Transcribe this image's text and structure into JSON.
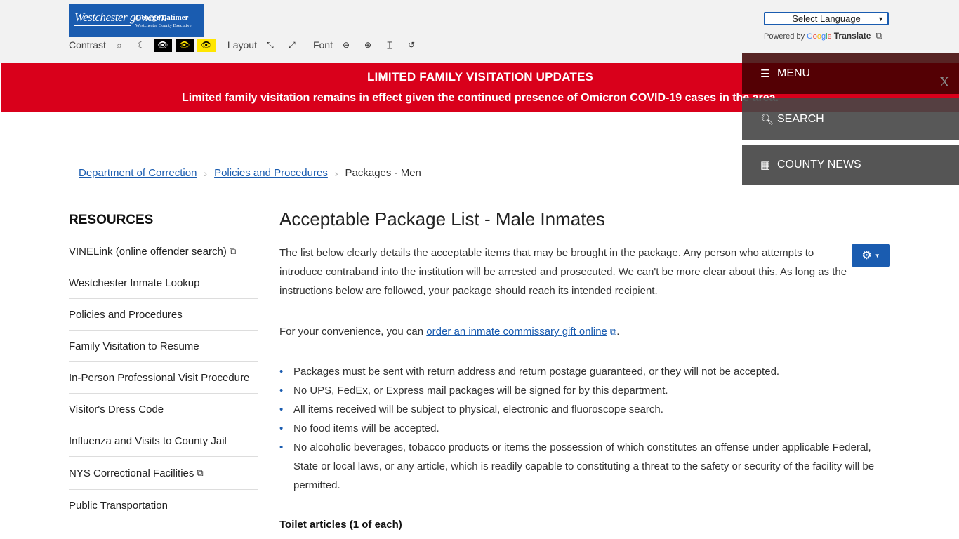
{
  "header": {
    "logo": {
      "site": "Westchester gov.com",
      "executive_name": "George Latimer",
      "executive_title": "Westchester County Executive"
    },
    "contrast_label": "Contrast",
    "layout_label": "Layout",
    "font_label": "Font",
    "language_select": {
      "selected": "Select Language"
    },
    "powered_by": "Powered by",
    "google": [
      "G",
      "o",
      "o",
      "g",
      "l",
      "e"
    ],
    "translate": "Translate"
  },
  "alert": {
    "title": "LIMITED FAMILY VISITATION UPDATES",
    "link_text": "Limited family visitation remains in effect",
    "text": " given the continued presence of Omicron COVID-19 cases in the area."
  },
  "side_menu": {
    "menu": "MENU",
    "search": "SEARCH",
    "news": "COUNTY NEWS",
    "close": "X"
  },
  "breadcrumb": {
    "items": [
      "Department of Correction",
      "Policies and Procedures"
    ],
    "current": "Packages - Men"
  },
  "sidebar": {
    "heading": "RESOURCES",
    "items": [
      {
        "label": "VINELink (online offender search)",
        "external": true
      },
      {
        "label": "Westchester Inmate Lookup",
        "external": false
      },
      {
        "label": "Policies and Procedures",
        "external": false
      },
      {
        "label": "Family Visitation to Resume",
        "external": false
      },
      {
        "label": "In-Person Professional Visit Procedure",
        "external": false
      },
      {
        "label": "Visitor's Dress Code",
        "external": false
      },
      {
        "label": "Influenza and Visits to County Jail",
        "external": false
      },
      {
        "label": "NYS Correctional Facilities",
        "external": true
      },
      {
        "label": "Public Transportation",
        "external": false
      }
    ]
  },
  "main": {
    "title": "Acceptable Package List - Male Inmates",
    "intro": "The list below clearly details the acceptable items that may be brought in the package. Any person who attempts to introduce contraband into the institution will be arrested and prosecuted. We can't be more clear about this. As long as the instructions below are followed, your package should reach its intended recipient.",
    "convenience_prefix": "For your convenience, you can ",
    "convenience_link": "order an inmate commissary gift online",
    "convenience_suffix": ".",
    "rules": [
      "Packages must be sent with return address and return postage guaranteed, or they will not be accepted.",
      "No UPS, FedEx, or Express mail packages will be signed for by this department.",
      "All items received will be subject to physical, electronic and fluoroscope search.",
      "No food items will be accepted.",
      "No alcoholic beverages, tobacco products or items the possession of which constitutes an offense under applicable Federal, State or local laws, or any article, which is readily capable to constituting a threat to the safety or security of the facility will be permitted."
    ],
    "section_heading": "Toilet articles (1 of each)"
  },
  "colors": {
    "brand_blue": "#1a5cb0",
    "alert_red": "#d9001b",
    "panel_gray": "#555555"
  }
}
